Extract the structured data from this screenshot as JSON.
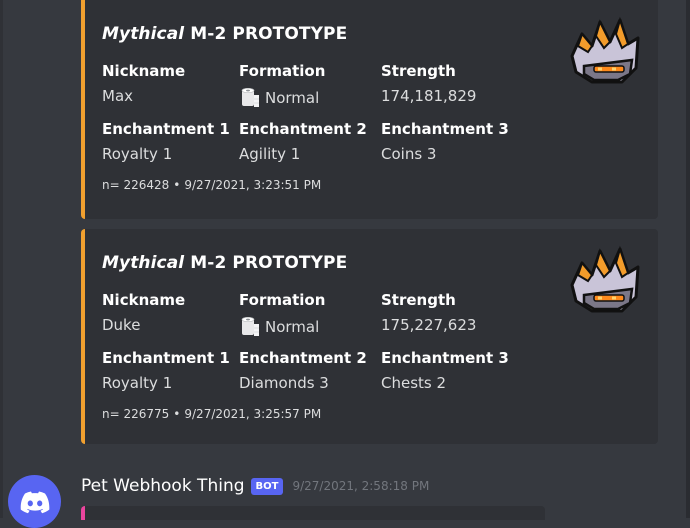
{
  "embeds": [
    {
      "rarity": "Mythical",
      "title": "M-2 PROTOTYPE",
      "fields": {
        "nickname_label": "Nickname",
        "nickname": "Max",
        "formation_label": "Formation",
        "formation": "Normal",
        "strength_label": "Strength",
        "strength": "174,181,829",
        "ench1_label": "Enchantment 1",
        "ench1": "Royalty 1",
        "ench2_label": "Enchantment 2",
        "ench2": "Agility 1",
        "ench3_label": "Enchantment 3",
        "ench3": "Coins 3"
      },
      "footer_id": "n= 226428",
      "footer_sep": "•",
      "footer_time": "9/27/2021, 3:23:51 PM",
      "formation_icon": "toilet-paper-icon",
      "thumbnail": "m2-prototype-pet-image"
    },
    {
      "rarity": "Mythical",
      "title": "M-2 PROTOTYPE",
      "fields": {
        "nickname_label": "Nickname",
        "nickname": "Duke",
        "formation_label": "Formation",
        "formation": "Normal",
        "strength_label": "Strength",
        "strength": "175,227,623",
        "ench1_label": "Enchantment 1",
        "ench1": "Royalty 1",
        "ench2_label": "Enchantment 2",
        "ench2": "Diamonds 3",
        "ench3_label": "Enchantment 3",
        "ench3": "Chests 2"
      },
      "footer_id": "n= 226775",
      "footer_sep": "•",
      "footer_time": "9/27/2021, 3:25:57 PM",
      "formation_icon": "toilet-paper-icon",
      "thumbnail": "m2-prototype-pet-image"
    }
  ],
  "next_message": {
    "author": "Pet Webhook Thing",
    "bot_tag": "BOT",
    "timestamp": "9/27/2021, 2:58:18 PM",
    "avatar_icon": "discord-logo-icon"
  },
  "colors": {
    "background": "#36393f",
    "embed_bg": "#2f3136",
    "embed_border": "#f1a02f",
    "next_embed_border": "#eb459e",
    "blurple": "#5865f2"
  }
}
